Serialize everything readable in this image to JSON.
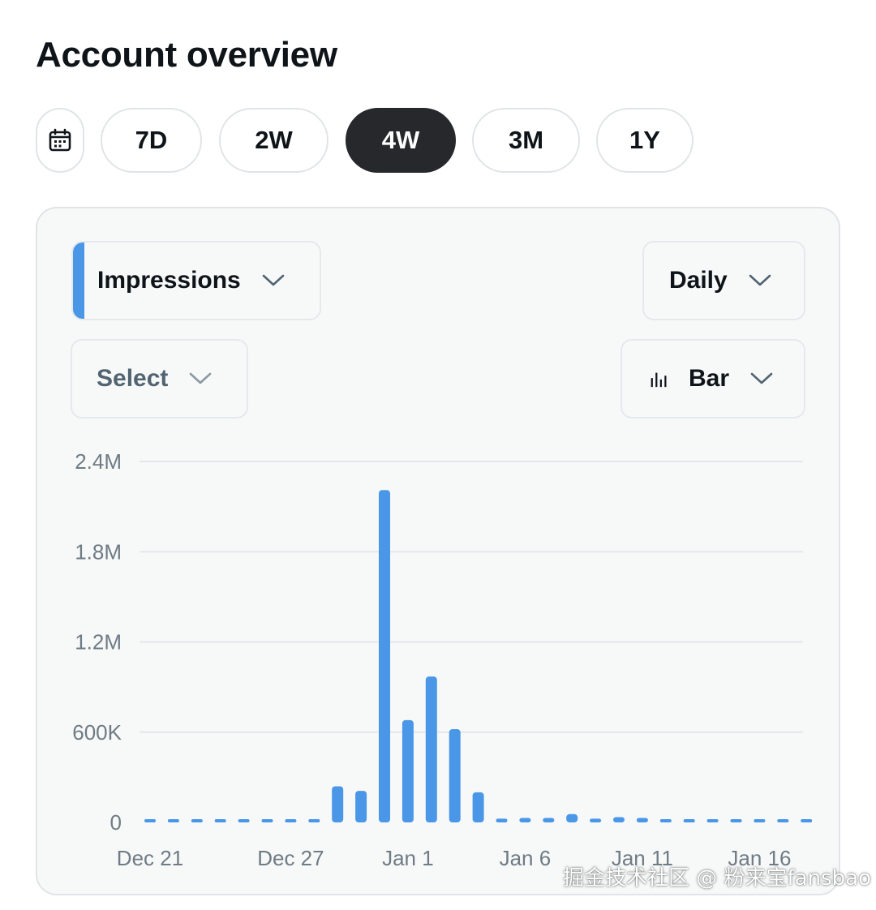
{
  "page": {
    "title": "Account overview"
  },
  "range_buttons": {
    "items": [
      {
        "label": "7D",
        "active": false
      },
      {
        "label": "2W",
        "active": false
      },
      {
        "label": "4W",
        "active": true
      },
      {
        "label": "3M",
        "active": false
      },
      {
        "label": "1Y",
        "active": false
      }
    ]
  },
  "controls": {
    "metric": {
      "label": "Impressions",
      "accent": "#4a97e8"
    },
    "compare": {
      "label": "Select"
    },
    "granularity": {
      "label": "Daily"
    },
    "chart_style": {
      "label": "Bar",
      "icon": "bar-chart-icon"
    }
  },
  "colors": {
    "bar": "#4a97e8",
    "active_button_bg": "#26282c",
    "card_bg": "#f7f9f9",
    "grid": "#e3e7ea"
  },
  "chart_data": {
    "type": "bar",
    "y_tick_labels": [
      "0",
      "600K",
      "1.2M",
      "1.8M",
      "2.4M"
    ],
    "y_tick_values": [
      0,
      600000,
      1200000,
      1800000,
      2400000
    ],
    "ylim": [
      0,
      2400000
    ],
    "x_tick_labels": [
      {
        "label": "Dec 21",
        "index": 0
      },
      {
        "label": "Dec 27",
        "index": 6
      },
      {
        "label": "Jan 1",
        "index": 11
      },
      {
        "label": "Jan 6",
        "index": 16
      },
      {
        "label": "Jan 11",
        "index": 21
      },
      {
        "label": "Jan 16",
        "index": 26
      }
    ],
    "categories": [
      "Dec 21",
      "Dec 22",
      "Dec 23",
      "Dec 24",
      "Dec 25",
      "Dec 26",
      "Dec 27",
      "Dec 28",
      "Dec 29",
      "Dec 30",
      "Dec 31",
      "Jan 1",
      "Jan 2",
      "Jan 3",
      "Jan 4",
      "Jan 5",
      "Jan 6",
      "Jan 7",
      "Jan 8",
      "Jan 9",
      "Jan 10",
      "Jan 11",
      "Jan 12",
      "Jan 13",
      "Jan 14",
      "Jan 15",
      "Jan 16",
      "Jan 17",
      "Jan 18"
    ],
    "values": [
      5000,
      5000,
      5000,
      5000,
      5000,
      5000,
      5000,
      20000,
      240000,
      210000,
      2210000,
      680000,
      970000,
      620000,
      200000,
      25000,
      30000,
      30000,
      55000,
      25000,
      35000,
      30000,
      15000,
      10000,
      10000,
      10000,
      20000,
      20000,
      5000
    ],
    "grid": true,
    "legend": "none",
    "title": "",
    "xlabel": "",
    "ylabel": ""
  },
  "watermark": {
    "text": "掘金技术社区 @ 粉来宝fansbao"
  }
}
